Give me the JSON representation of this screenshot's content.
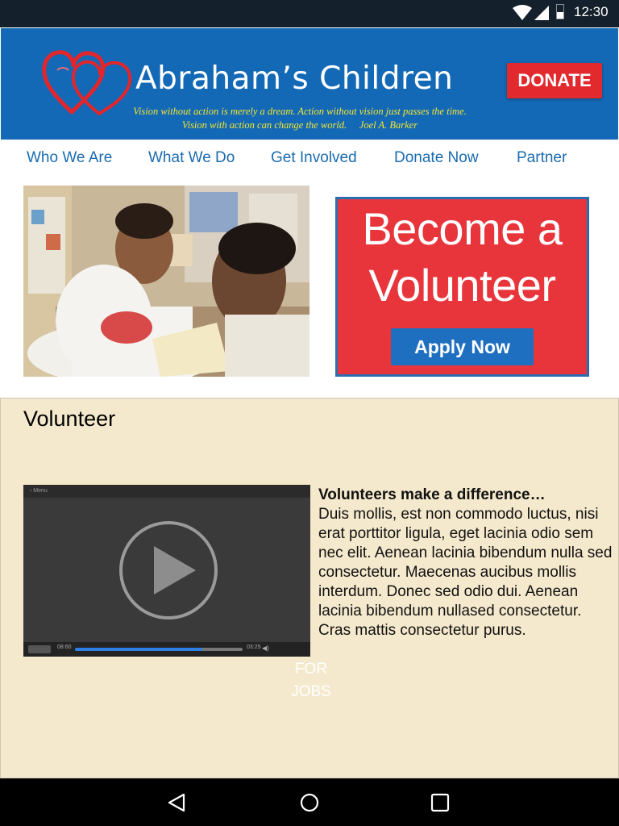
{
  "status_bar": {
    "time": "12:30",
    "icons": [
      "wifi-icon",
      "cell-signal-icon",
      "battery-icon"
    ]
  },
  "header": {
    "title": "Abraham’s Children",
    "tagline_line1": "Vision without action is merely a dream. Action without vision just passes the time.",
    "tagline_line2": "Vision with action can change the world.     Joel A. Barker",
    "donate_label": "DONATE",
    "colors": {
      "bar": "#1369b5",
      "donate": "#e22a2e",
      "tagline": "#f5e632"
    }
  },
  "nav": {
    "items": [
      {
        "label": "Who We Are"
      },
      {
        "label": "What We Do"
      },
      {
        "label": "Get Involved"
      },
      {
        "label": "Donate Now"
      },
      {
        "label": "Partner"
      }
    ]
  },
  "hero": {
    "banner_line1": "Become a",
    "banner_line2": "Volunteer",
    "apply_label": "Apply Now",
    "colors": {
      "banner": "#e8353c",
      "button": "#1f6fc0"
    }
  },
  "content": {
    "title": "Volunteer",
    "video": {
      "top_label": "‹ Menu",
      "time_elapsed": "08:60",
      "time_total": "03:25",
      "progress": 0.76
    },
    "overlay_line1": "FOR",
    "overlay_line2": "JOBS",
    "article_lead": "Volunteers make a difference…",
    "article_body": "Duis mollis, est non commodo luctus, nisi erat porttitor ligula, eget lacinia odio sem nec elit. Aenean lacinia bibendum nulla sed consectetur. Maecenas aucibus mollis interdum. Donec sed odio dui. Aenean lacinia bibendum nullased consectetur. Cras mattis consectetur purus."
  },
  "android_nav": {
    "buttons": [
      "back-icon",
      "home-icon",
      "recents-icon"
    ]
  }
}
